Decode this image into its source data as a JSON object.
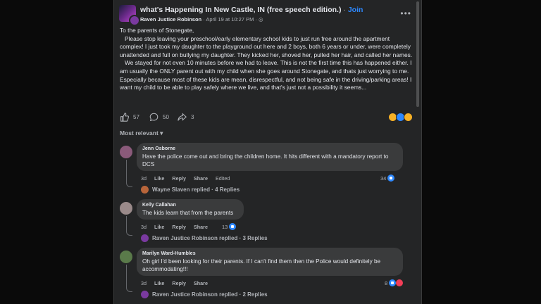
{
  "post": {
    "group_name": "what's Happening In New Castle, IN (free speech edition.)",
    "separator": "·",
    "join_label": "Join",
    "author": "Raven Justice Robinson",
    "timestamp": "April 19 at 10:27 PM",
    "privacy_glyph": "· ◎",
    "more_label": "•••",
    "body_paragraphs": [
      "To the parents of Stonegate,",
      "   Please stop leaving your preschool/early elementary school kids to just run free around the apartment complex! I just took my daughter to the playground out here and 2 boys, both 6 years or under, were completely unattended and full on bullying my daughter. They kicked her, shoved her, pulled her hair, and called her names.",
      "   We stayed for not even 10 minutes before we had to leave. This is not the first time this has happened either. I am usually the ONLY parent out with my child when she goes around Stonegate, and thats just worrying to me. Especially because most of these kids are mean, disrespectful, and not being safe in the driving/parking areas! I want my child to be able to play safely where we live, and that's just not a possibility it seems..."
    ],
    "like_count": "57",
    "comment_count": "50",
    "share_count": "3"
  },
  "sort_label": "Most relevant ▾",
  "comments": [
    {
      "name": "Jenn Osborne",
      "text": "Have the police come out and bring the children home. It hits different with a mandatory report to DCS",
      "time": "3d",
      "like": "Like",
      "reply": "Reply",
      "share": "Share",
      "edited": "Edited",
      "reactions": "34",
      "replies_text": "Wayne Slaven replied · 4 Replies"
    },
    {
      "name": "Kelly Callahan",
      "text": "The kids learn that from the parents",
      "time": "3d",
      "like": "Like",
      "reply": "Reply",
      "share": "Share",
      "reactions": "13",
      "replies_text": "Raven Justice Robinson replied · 3 Replies"
    },
    {
      "name": "Marilyn Ward-Humbles",
      "text": "Oh girl I'd been looking for their parents. If I can't find them then the Police would definitely be accommodating!!!",
      "time": "3d",
      "like": "Like",
      "reply": "Reply",
      "share": "Share",
      "reactions": "8",
      "replies_text": "Raven Justice Robinson replied · 2 Replies"
    }
  ],
  "colors": {
    "background": "#242526",
    "bubble": "#3a3b3c",
    "accent": "#2d88ff",
    "text": "#e4e6eb",
    "muted": "#b0b3b8"
  }
}
